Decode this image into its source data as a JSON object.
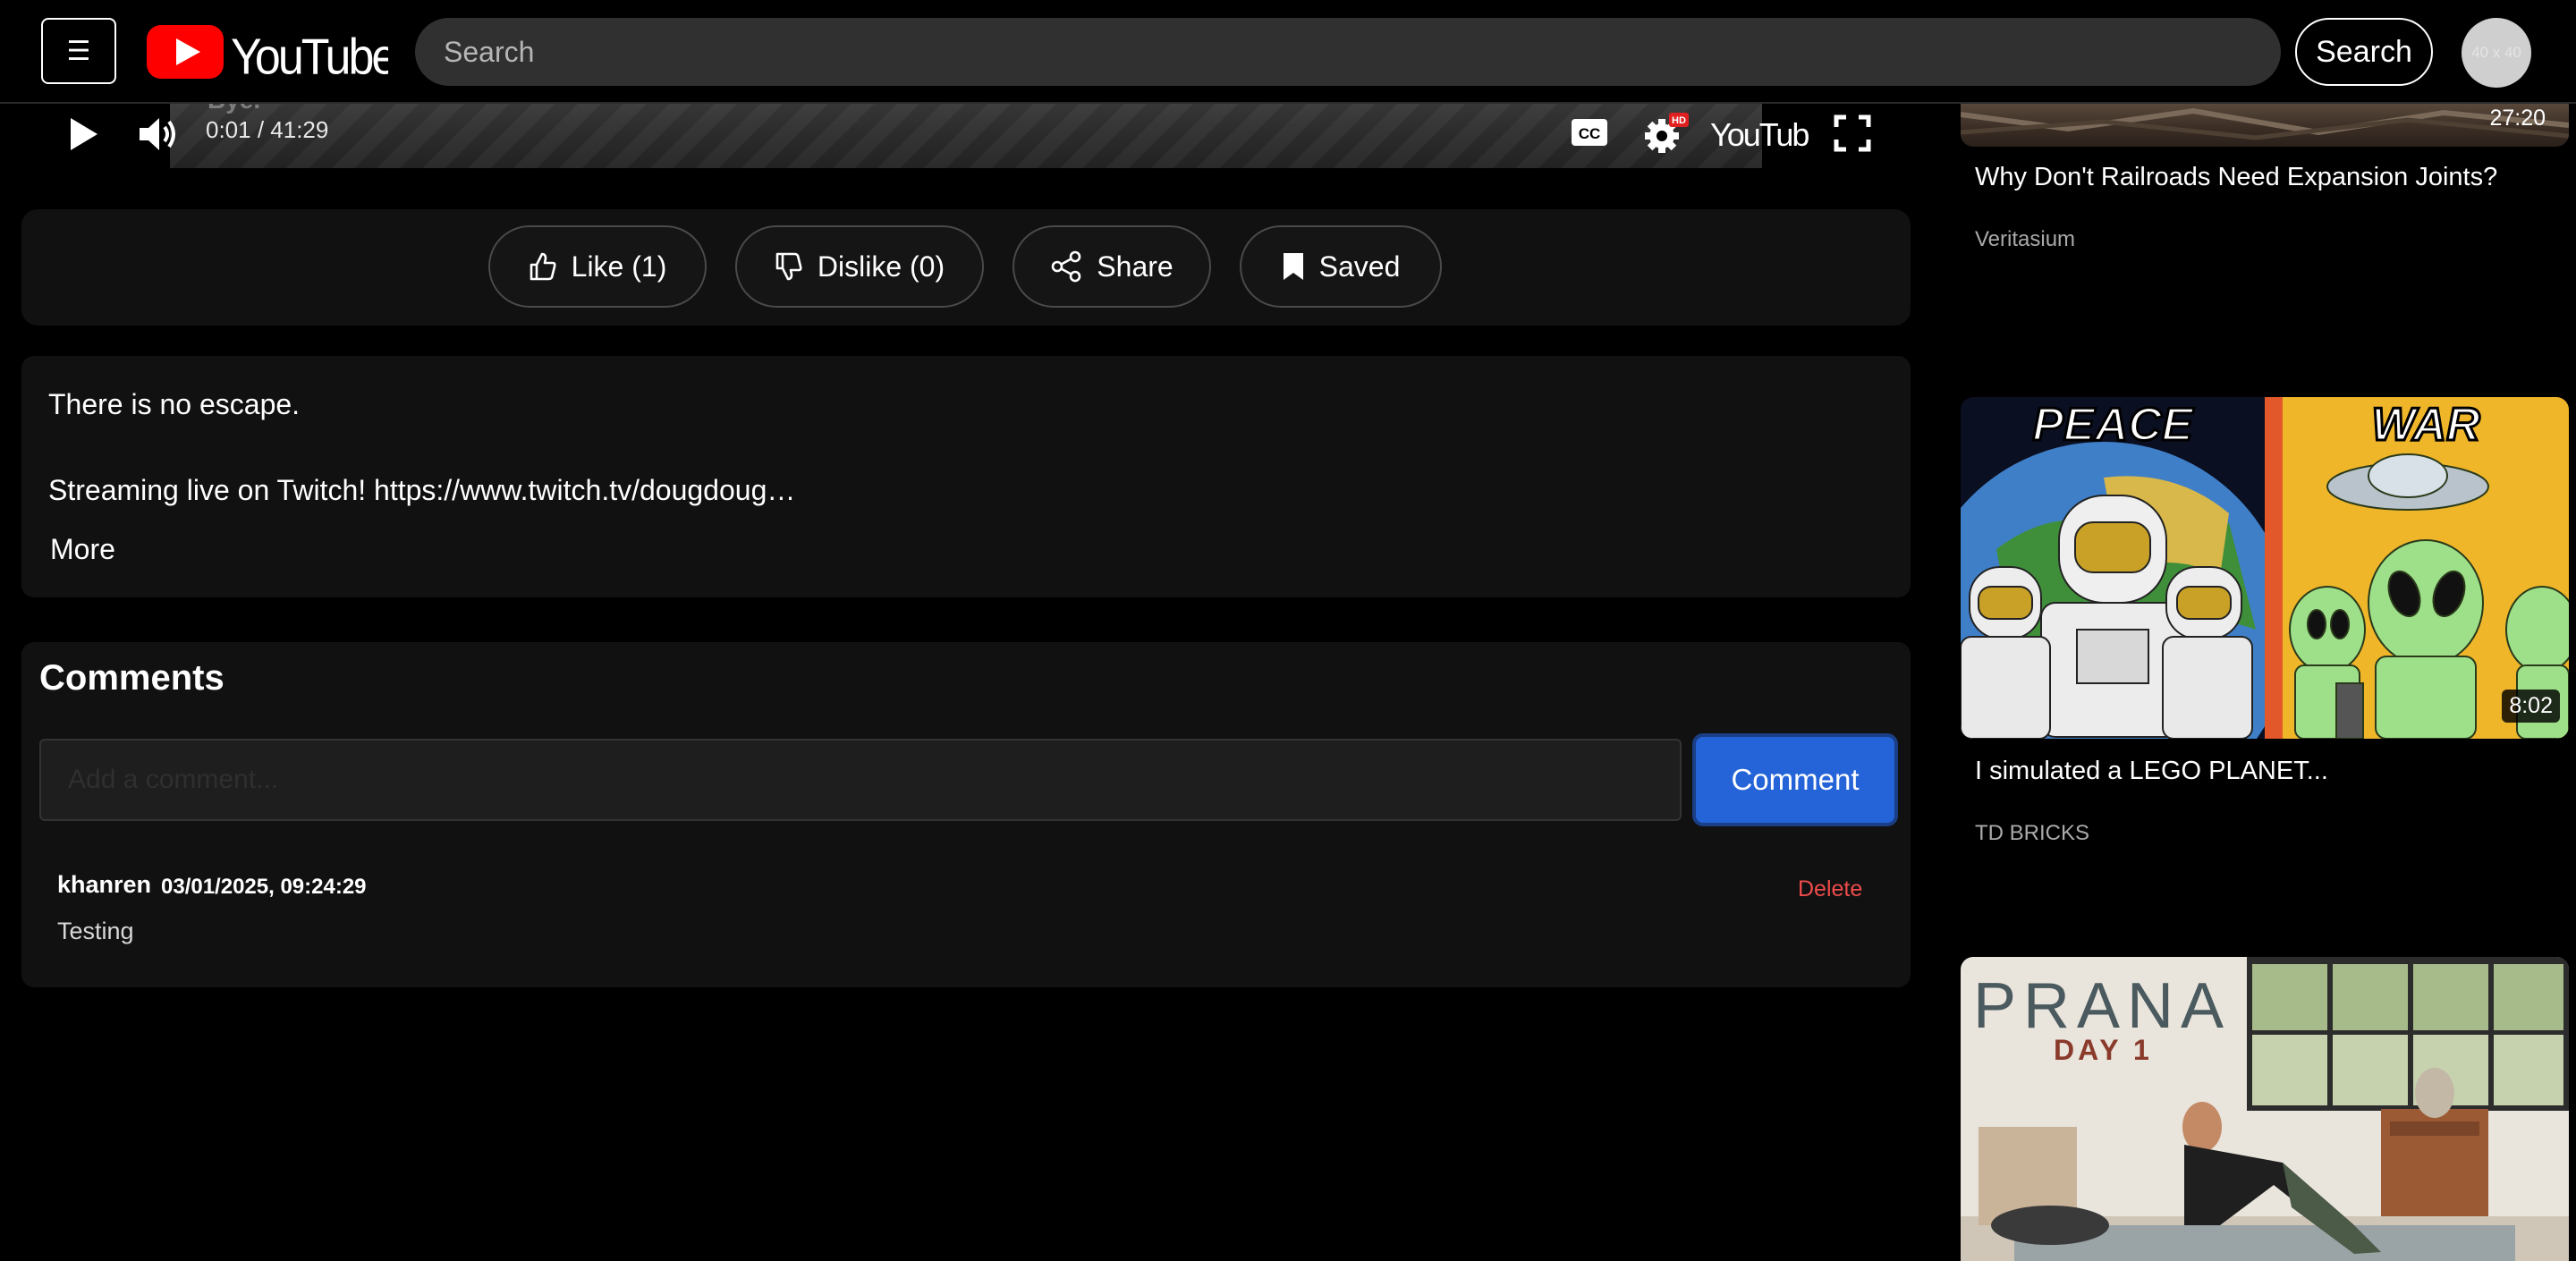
{
  "header": {
    "menu_icon": "☰",
    "logo_text": "YouTube",
    "search_placeholder": "Search",
    "search_button": "Search",
    "avatar_text": "40 x 40"
  },
  "player": {
    "caption": "Bye.",
    "time": "0:01 / 41:29",
    "cc_label": "CC",
    "hd_badge": "HD",
    "brand": "YouTube"
  },
  "actions": {
    "like": "Like (1)",
    "dislike": "Dislike (0)",
    "share": "Share",
    "saved": "Saved"
  },
  "description": {
    "line1": "There is no escape.",
    "line2": "Streaming live on Twitch! https://www.twitch.tv/dougdoug…",
    "more": "More"
  },
  "comments": {
    "title": "Comments",
    "input_placeholder": "Add a comment...",
    "submit": "Comment",
    "items": [
      {
        "author": "khanren",
        "date": "03/01/2025, 09:24:29",
        "text": "Testing",
        "delete": "Delete"
      }
    ]
  },
  "sidebar": {
    "videos": [
      {
        "title": "Why Don't Railroads Need Expansion Joints?",
        "channel": "Veritasium",
        "duration": "27:20"
      },
      {
        "title": "I simulated a LEGO PLANET...",
        "channel": "TD BRICKS",
        "duration": "8:02",
        "thumb_text_left": "PEACE",
        "thumb_text_right": "WAR"
      },
      {
        "title": "",
        "channel": "",
        "duration": "",
        "thumb_text": "PRANA",
        "thumb_subtext": "DAY 1"
      }
    ]
  },
  "colors": {
    "background": "#000000",
    "panel": "#111111",
    "accent": "#2463d8",
    "logo_red": "#ff0000",
    "delete_red": "#ef4b4b"
  }
}
